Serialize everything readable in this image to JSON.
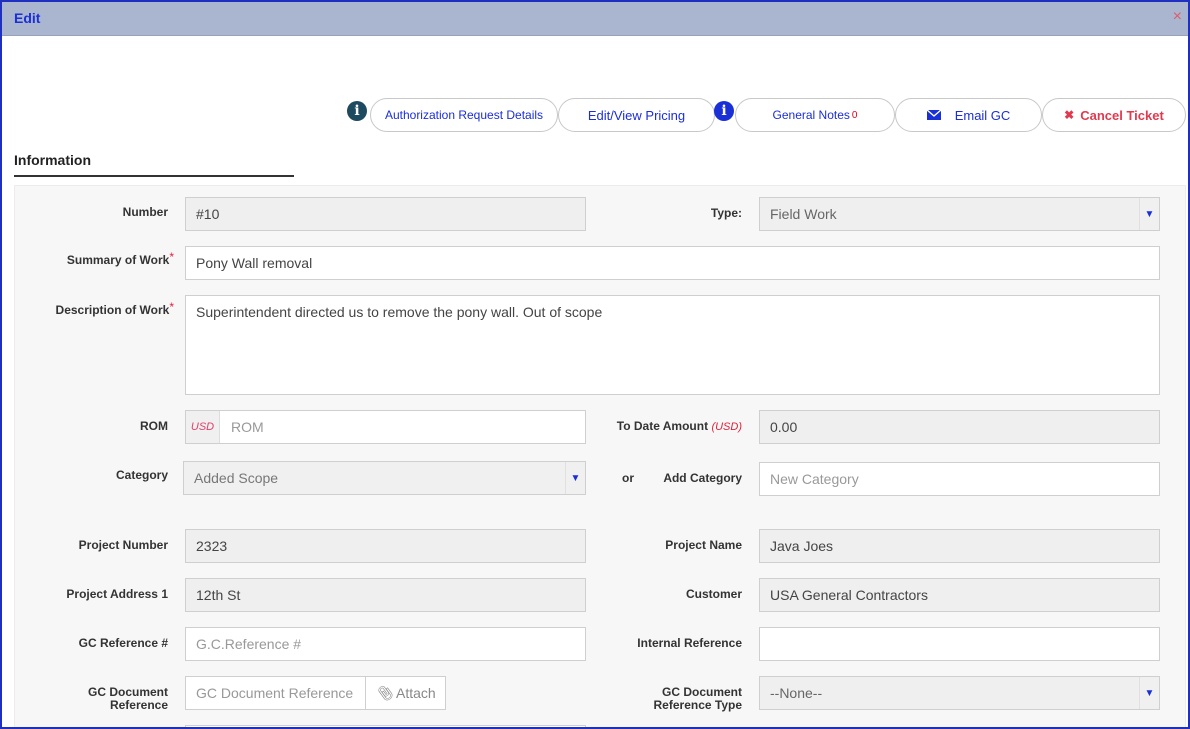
{
  "window": {
    "title": "Edit",
    "close_glyph": "×"
  },
  "toolbar": {
    "auth_info_icon": "info-icon",
    "auth_label": "Authorization Request Details",
    "pricing_label": "Edit/View Pricing",
    "notes_info_icon": "info-icon",
    "notes_label": "General Notes",
    "notes_count": "0",
    "email_label": "Email GC",
    "email_icon": "envelope-icon",
    "cancel_label": "Cancel Ticket",
    "cancel_icon": "x-icon"
  },
  "section": {
    "title": "Information"
  },
  "form": {
    "number": {
      "label": "Number",
      "value": "#10"
    },
    "type": {
      "label": "Type:",
      "value": "Field Work"
    },
    "summary": {
      "label": "Summary of Work",
      "required": "*",
      "value": "Pony Wall removal"
    },
    "description": {
      "label": "Description of Work",
      "required": "*",
      "value": "Superintendent directed us to remove the pony wall. Out of scope"
    },
    "rom": {
      "label": "ROM",
      "currency": "USD",
      "placeholder": "ROM"
    },
    "to_date": {
      "label": "To Date Amount",
      "currency": "(USD)",
      "value": "0.00"
    },
    "category": {
      "label": "Category",
      "value": "Added Scope",
      "or_label": "or"
    },
    "add_category": {
      "label": "Add Category",
      "placeholder": "New Category"
    },
    "project_number": {
      "label": "Project Number",
      "value": "2323"
    },
    "project_name": {
      "label": "Project Name",
      "value": "Java Joes"
    },
    "project_address": {
      "label": "Project Address 1",
      "value": "12th St"
    },
    "customer": {
      "label": "Customer",
      "value": "USA General Contractors"
    },
    "gc_reference": {
      "label": "GC Reference #",
      "placeholder": "G.C.Reference #"
    },
    "internal_reference": {
      "label": "Internal Reference",
      "value": ""
    },
    "gc_document": {
      "label_line1": "GC Document",
      "label_line2": "Reference",
      "placeholder": "GC Document Reference",
      "attach_label": "Attach"
    },
    "gc_document_type": {
      "label_line1": "GC Document",
      "label_line2": "Reference Type",
      "value": "--None--"
    }
  },
  "colors": {
    "accent": "#1a2fd6",
    "titlebar": "#aab6cf",
    "danger": "#e03a4f",
    "info_icon_dark": "#1d4a5e",
    "info_icon_blue": "#1a2fd6"
  }
}
